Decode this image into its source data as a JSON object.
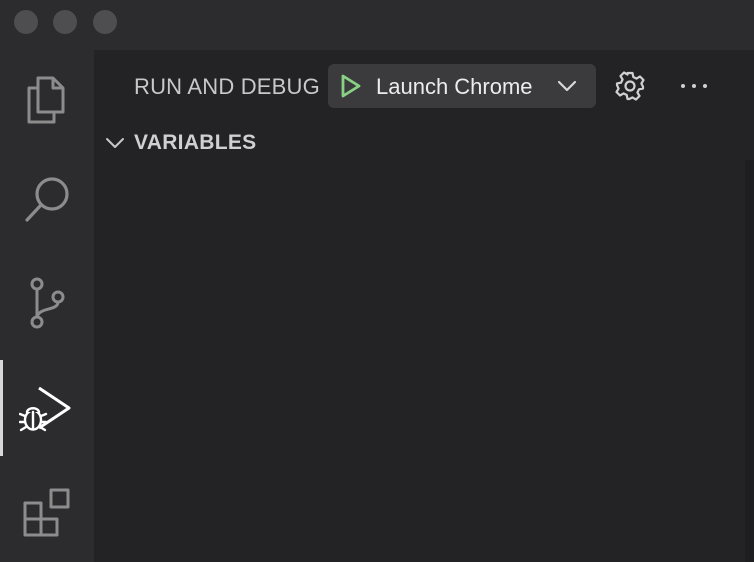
{
  "window": {
    "controls": [
      "close",
      "minimize",
      "zoom"
    ]
  },
  "activity_bar": {
    "items": [
      {
        "name": "explorer",
        "icon": "files-icon",
        "active": false
      },
      {
        "name": "search",
        "icon": "search-icon",
        "active": false
      },
      {
        "name": "source-control",
        "icon": "source-control-icon",
        "active": false
      },
      {
        "name": "run-and-debug",
        "icon": "run-debug-icon",
        "active": true
      },
      {
        "name": "extensions",
        "icon": "extensions-icon",
        "active": false
      }
    ]
  },
  "sidebar": {
    "title": "RUN AND DEBUG",
    "launch_config": {
      "selected": "Launch Chrome",
      "play_icon": "play-icon",
      "dropdown_icon": "chevron-down-icon"
    },
    "actions": [
      {
        "name": "settings",
        "icon": "gear-icon"
      },
      {
        "name": "more-actions",
        "icon": "ellipsis-icon"
      }
    ],
    "sections": [
      {
        "title": "VARIABLES",
        "expanded": true
      }
    ]
  },
  "colors": {
    "background": "#232325",
    "activity_bar": "#2c2c2e",
    "play_green": "#89d185",
    "icon_gray": "#8c8c8c",
    "active_icon": "#ffffff"
  }
}
